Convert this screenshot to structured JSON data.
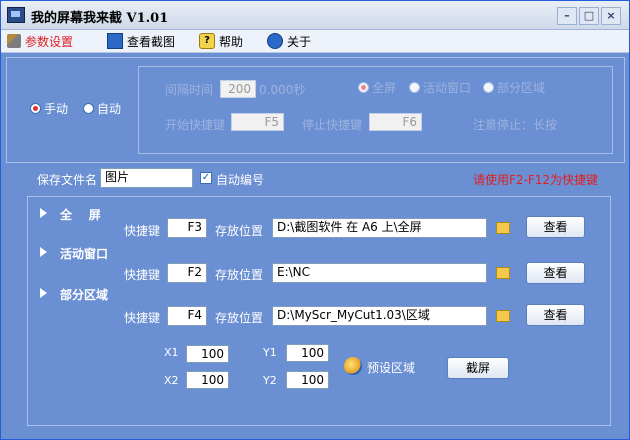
{
  "window": {
    "title": "我的屏幕我来截 V1.01",
    "min": "–",
    "max": "□",
    "close": "×"
  },
  "menu": {
    "settings": "参数设置",
    "view": "查看截图",
    "help": "帮助",
    "about": "关于",
    "help_glyph": "?"
  },
  "mode": {
    "manual": "手动",
    "auto": "自动",
    "selected": "manual"
  },
  "timer": {
    "interval_label": "间隔时间",
    "interval_value": "200",
    "interval_unit": "0.000秒",
    "scope_fullscreen": "全屏",
    "scope_active": "活动窗口",
    "scope_region": "部分区域",
    "scope_selected": "fullscreen",
    "start_label": "开始快捷键",
    "start_value": "F5",
    "stop_label": "停止快捷键",
    "stop_value": "F6",
    "note": "注意停止：长按"
  },
  "save": {
    "filename_label": "保存文件名",
    "filename_value": "图片",
    "auto_number": "自动编号",
    "auto_number_checked": true,
    "hint": "请使用F2-F12为快捷键",
    "check_glyph": "✓"
  },
  "captures": [
    {
      "title": "全    屏",
      "hotkey_label": "快捷键",
      "hotkey": "F3",
      "path_label": "存放位置",
      "path": "D:\\截图软件 在 A6 上\\全屏",
      "view": "查看"
    },
    {
      "title": "活动窗口",
      "hotkey_label": "快捷键",
      "hotkey": "F2",
      "path_label": "存放位置",
      "path": "E:\\NC",
      "view": "查看"
    },
    {
      "title": "部分区域",
      "hotkey_label": "快捷键",
      "hotkey": "F4",
      "path_label": "存放位置",
      "path": "D:\\MyScr_MyCut1.03\\区域",
      "view": "查看"
    }
  ],
  "region": {
    "x1_label": "X1",
    "x1": "100",
    "x2_label": "X2",
    "x2": "100",
    "y1_label": "Y1",
    "y1": "100",
    "y2_label": "Y2",
    "y2": "100",
    "preset": "预设区域",
    "capture": "截屏"
  },
  "colors": {
    "panel_bg": "#6b8fd3",
    "hint_red": "#e02020"
  },
  "icons": {
    "app": "camera-app-icon",
    "settings": "tools-icon",
    "view": "image-icon",
    "help": "help-icon",
    "about": "info-icon",
    "folder": "folder-icon",
    "arrow": "arrow-right-icon",
    "preset": "preset-region-icon"
  }
}
